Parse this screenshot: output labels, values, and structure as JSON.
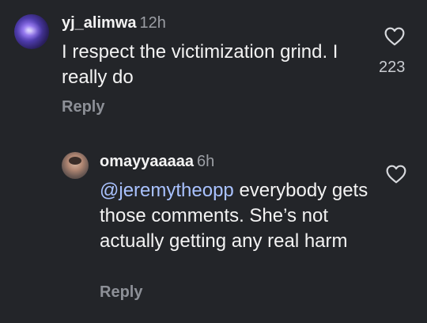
{
  "comments": [
    {
      "username": "yj_alimwa",
      "time": "12h",
      "text": "I respect the victimization grind. I really do",
      "reply_label": "Reply",
      "likes": "223",
      "heart_icon": "heart-outline-icon"
    },
    {
      "username": "omayyaaaaa",
      "time": "6h",
      "mention": "@jeremytheopp",
      "text": " everybody gets those comments. She’s not actually getting any real harm",
      "reply_label": "Reply",
      "heart_icon": "heart-outline-icon"
    }
  ],
  "colors": {
    "background": "#232529",
    "mention": "#a9c2ff",
    "muted": "#9b9ea4"
  }
}
